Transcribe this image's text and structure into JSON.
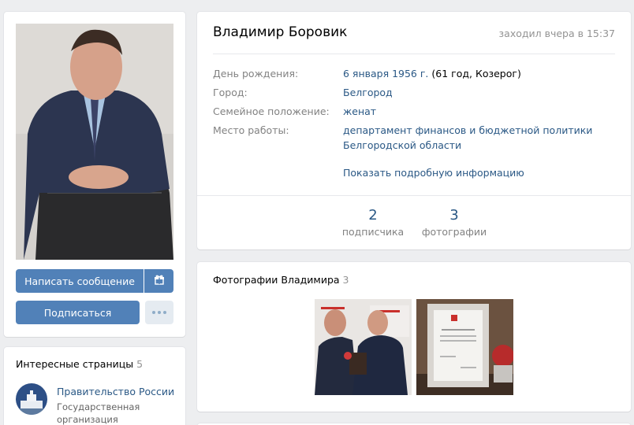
{
  "profile": {
    "name": "Владимир Боровик",
    "online": "заходил вчера в 15:37",
    "fields": [
      {
        "label": "День рождения:",
        "value": "6 января 1956 г.",
        "extra": " (61 год, Козерог)"
      },
      {
        "label": "Город:",
        "value": "Белгород"
      },
      {
        "label": "Семейное положение:",
        "value": "женат"
      },
      {
        "label": "Место работы:",
        "value_line1": "департамент финансов и бюджетной политики",
        "value_line2": "Белгородской области"
      }
    ],
    "show_more": "Показать подробную информацию",
    "counters": [
      {
        "num": "2",
        "caption": "подписчика"
      },
      {
        "num": "3",
        "caption": "фотографии"
      }
    ]
  },
  "actions": {
    "message": "Написать сообщение",
    "gift_icon": "gift-icon",
    "subscribe": "Подписаться",
    "more_icon": "more-dots-icon"
  },
  "interesting": {
    "title": "Интересные страницы",
    "count": "5",
    "items": [
      {
        "name": "Правительство России",
        "desc": "Государственная организация"
      }
    ]
  },
  "photos": {
    "title": "Фотографии Владимира",
    "count": "3"
  },
  "colors": {
    "accent": "#5181b8",
    "link": "#2a5885",
    "background": "#edeef0"
  }
}
